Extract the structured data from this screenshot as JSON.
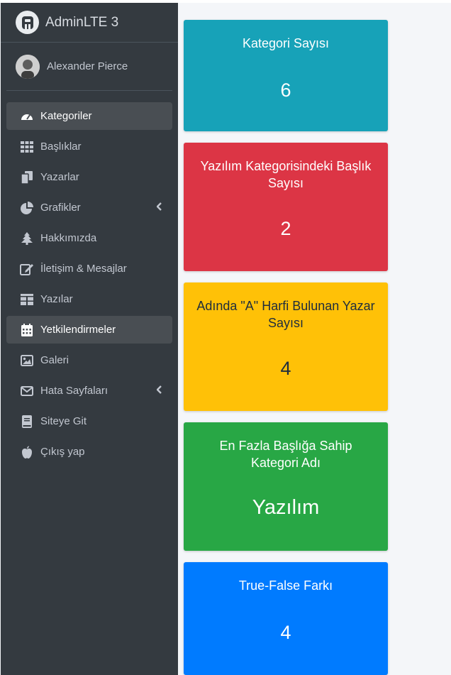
{
  "brand": {
    "name": "AdminLTE 3"
  },
  "user": {
    "name": "Alexander Pierce"
  },
  "nav": {
    "items": [
      {
        "label": "Kategoriler",
        "icon": "dashboard-icon",
        "active": true
      },
      {
        "label": "Başlıklar",
        "icon": "grid-icon"
      },
      {
        "label": "Yazarlar",
        "icon": "copy-icon"
      },
      {
        "label": "Grafikler",
        "icon": "pie-chart-icon",
        "has_submenu": true
      },
      {
        "label": "Hakkımızda",
        "icon": "tree-icon"
      },
      {
        "label": "İletişim & Mesajlar",
        "icon": "edit-icon"
      },
      {
        "label": "Yazılar",
        "icon": "table-icon"
      },
      {
        "label": "Yetkilendirmeler",
        "icon": "calendar-icon",
        "active": true
      },
      {
        "label": "Galeri",
        "icon": "image-icon"
      },
      {
        "label": "Hata Sayfaları",
        "icon": "envelope-icon",
        "has_submenu": true
      },
      {
        "label": "Siteye Git",
        "icon": "book-icon"
      },
      {
        "label": "Çıkış yap",
        "icon": "apple-icon"
      }
    ]
  },
  "stats": [
    {
      "title": "Kategori Sayısı",
      "value": "6",
      "color": "#17a2b8",
      "text_color": "#ffffff"
    },
    {
      "title": "Yazılım Kategorisindeki Başlık Sayısı",
      "value": "2",
      "color": "#dc3545",
      "text_color": "#ffffff"
    },
    {
      "title": "Adında \"A\" Harfi Bulunan Yazar Sayısı",
      "value": "4",
      "color": "#ffc107",
      "text_color": "#1f2d3d"
    },
    {
      "title": "En Fazla Başlığa Sahip Kategori Adı",
      "value": "Yazılım",
      "color": "#28a745",
      "text_color": "#ffffff"
    },
    {
      "title": "True-False Farkı",
      "value": "4",
      "color": "#007bff",
      "text_color": "#ffffff"
    }
  ]
}
